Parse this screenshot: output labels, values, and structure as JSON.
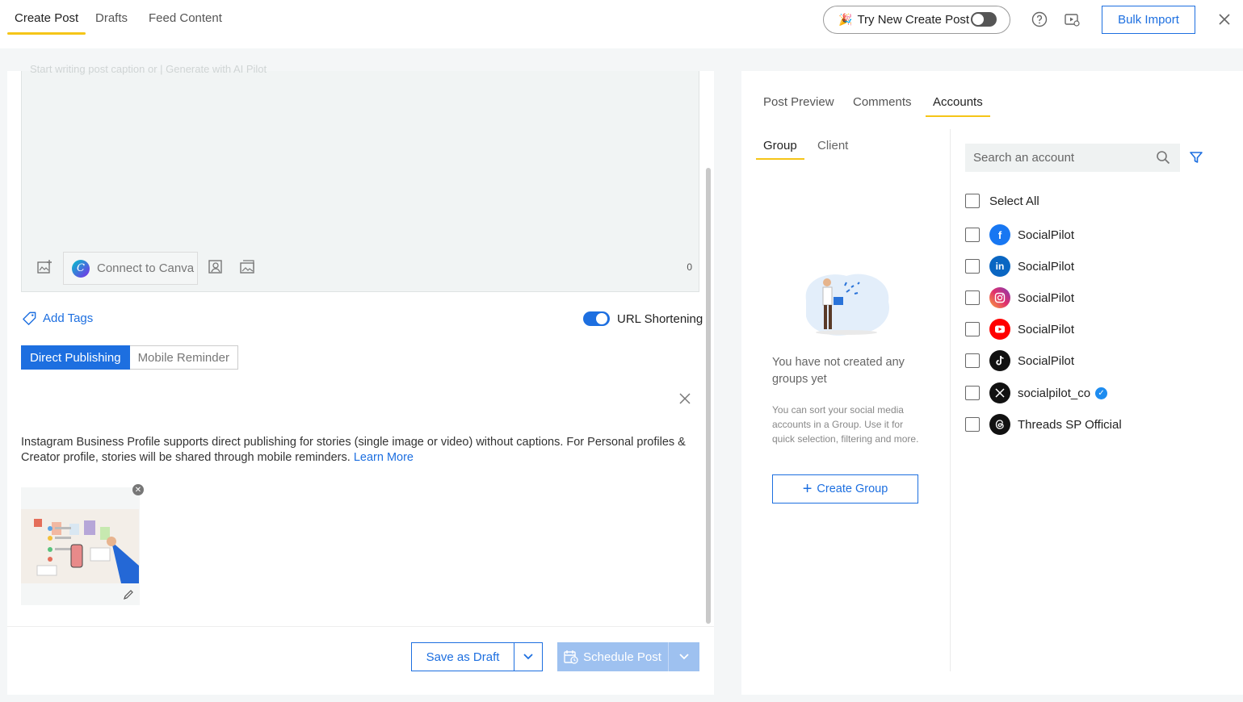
{
  "header": {
    "tabs": [
      {
        "label": "Create Post",
        "active": true
      },
      {
        "label": "Drafts",
        "active": false
      },
      {
        "label": "Feed Content",
        "active": false
      }
    ],
    "try_new_label": "Try New Create Post",
    "try_new_enabled": false,
    "bulk_import_label": "Bulk Import",
    "icons": [
      "help-icon",
      "video-tutorial-icon",
      "close-icon"
    ]
  },
  "editor": {
    "placeholder_faded": "Start writing post caption or  |  Generate with AI Pilot",
    "connect_canva_label": "Connect to Canva",
    "char_count": "0"
  },
  "options": {
    "add_tags_label": "Add Tags",
    "url_shortening_label": "URL Shortening",
    "url_shortening_enabled": true,
    "publish_modes": [
      "Direct Publishing",
      "Mobile Reminder"
    ],
    "selected_mode": "Direct Publishing"
  },
  "notice": {
    "text": "Instagram Business Profile supports direct publishing for stories (single image or video) without captions. For Personal profiles & Creator profile, stories will be shared through mobile reminders. ",
    "link_label": "Learn More"
  },
  "footer": {
    "save_draft_label": "Save as Draft",
    "schedule_label": "Schedule Post"
  },
  "right": {
    "tabs": [
      {
        "label": "Post Preview",
        "active": false
      },
      {
        "label": "Comments",
        "active": false
      },
      {
        "label": "Accounts",
        "active": true
      }
    ],
    "subtabs": [
      {
        "label": "Group",
        "active": true
      },
      {
        "label": "Client",
        "active": false
      }
    ],
    "no_groups_title": "You have not created any groups yet",
    "no_groups_desc": "You can sort your social media accounts in a Group. Use it for quick selection, filtering and more.",
    "create_group_label": "Create Group",
    "search_placeholder": "Search an account",
    "select_all_label": "Select All",
    "accounts": [
      {
        "network": "facebook",
        "name": "SocialPilot",
        "color": "#1877f2"
      },
      {
        "network": "linkedin",
        "name": "SocialPilot",
        "color": "#0a66c2"
      },
      {
        "network": "instagram",
        "name": "SocialPilot",
        "color": "#e1306c"
      },
      {
        "network": "youtube",
        "name": "SocialPilot",
        "color": "#ff0000"
      },
      {
        "network": "tiktok",
        "name": "SocialPilot",
        "color": "#111111"
      },
      {
        "network": "x",
        "name": "socialpilot_co",
        "color": "#111111",
        "verified": true
      },
      {
        "network": "threads",
        "name": "Threads SP Official",
        "color": "#111111"
      }
    ]
  }
}
